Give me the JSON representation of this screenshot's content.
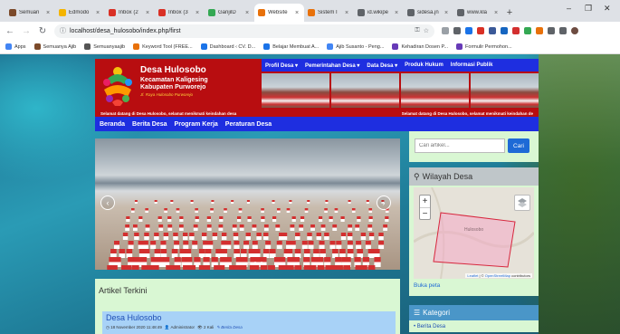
{
  "browser": {
    "tabs": [
      {
        "label": "Semuan",
        "color": "#7b4a2a",
        "active": false
      },
      {
        "label": "Edmodo",
        "color": "#f4b400",
        "active": false
      },
      {
        "label": "Inbox (2",
        "color": "#d93025",
        "active": false
      },
      {
        "label": "Inbox (3",
        "color": "#d93025",
        "active": false
      },
      {
        "label": "GanjilD",
        "color": "#34a853",
        "active": false
      },
      {
        "label": "Website",
        "color": "#e8710a",
        "active": true
      },
      {
        "label": "Sistem I",
        "color": "#e8710a",
        "active": false
      },
      {
        "label": "id.wikipe",
        "color": "#5f6368",
        "active": false
      },
      {
        "label": "sidesa.jn",
        "color": "#5f6368",
        "active": false
      },
      {
        "label": "www.kla",
        "color": "#5f6368",
        "active": false
      }
    ],
    "address": "localhost/desa_hulosobo/index.php/first",
    "bookmarks": [
      {
        "label": "Apps",
        "color": "#4285f4"
      },
      {
        "label": "Semuanya Ajib",
        "color": "#7b4a2a"
      },
      {
        "label": "Semuanyaajib",
        "color": "#555555"
      },
      {
        "label": "Keyword Tool (FREE...",
        "color": "#e8710a"
      },
      {
        "label": "Dashboard ‹ CV. D...",
        "color": "#1a73e8"
      },
      {
        "label": "Belajar Membuat A...",
        "color": "#1a73e8"
      },
      {
        "label": "Ajib Susanto - Peng...",
        "color": "#4285f4"
      },
      {
        "label": "Kehadiran Dosen P...",
        "color": "#673ab7"
      },
      {
        "label": "Formulir Permohon...",
        "color": "#673ab7"
      }
    ]
  },
  "site": {
    "title": "Desa Hulosobo",
    "subtitle1": "Kecamatan Kaligesing",
    "subtitle2": "Kabupaten Purworejo",
    "address": "Jl. Raya Hulosobo Purworejo",
    "top_menu": [
      "Profil Desa ▾",
      "Pemerintahan Desa ▾",
      "Data Desa ▾",
      "Produk Hukum",
      "Informasi Publik"
    ],
    "marquee": [
      "Selamat datang di Desa Hulosobo, selamat menikmati keindahan desa",
      "Selamat datang di Desa Hulosobo, selamat menikmati keindahan de"
    ],
    "main_menu": [
      "Beranda",
      "Berita Desa",
      "Program Kerja",
      "Peraturan Desa"
    ],
    "carousel": {
      "prev": "‹",
      "next": "›"
    },
    "articles": {
      "heading": "Artikel Terkini",
      "items": [
        {
          "title": "Desa Hulosobo",
          "date": "◷ 18 November 2020 11:48:49",
          "author": "👤 Administrator",
          "views": "👁 2 Kali",
          "category": "✎ Berita Desa"
        }
      ]
    },
    "sidebar": {
      "search_placeholder": "Cari artikel...",
      "search_button": "Cari",
      "wilayah_title": "Wilayah Desa",
      "map_label": "Hulosobo",
      "attribution_prefix": "Leaflet",
      "attribution_mid": " | © ",
      "attribution_link": "OpenStreetMap",
      "attribution_suffix": " contributors",
      "buka_peta": "Buka peta",
      "kategori_title": "Kategori",
      "kategori_items": [
        "Berita Desa"
      ]
    }
  }
}
